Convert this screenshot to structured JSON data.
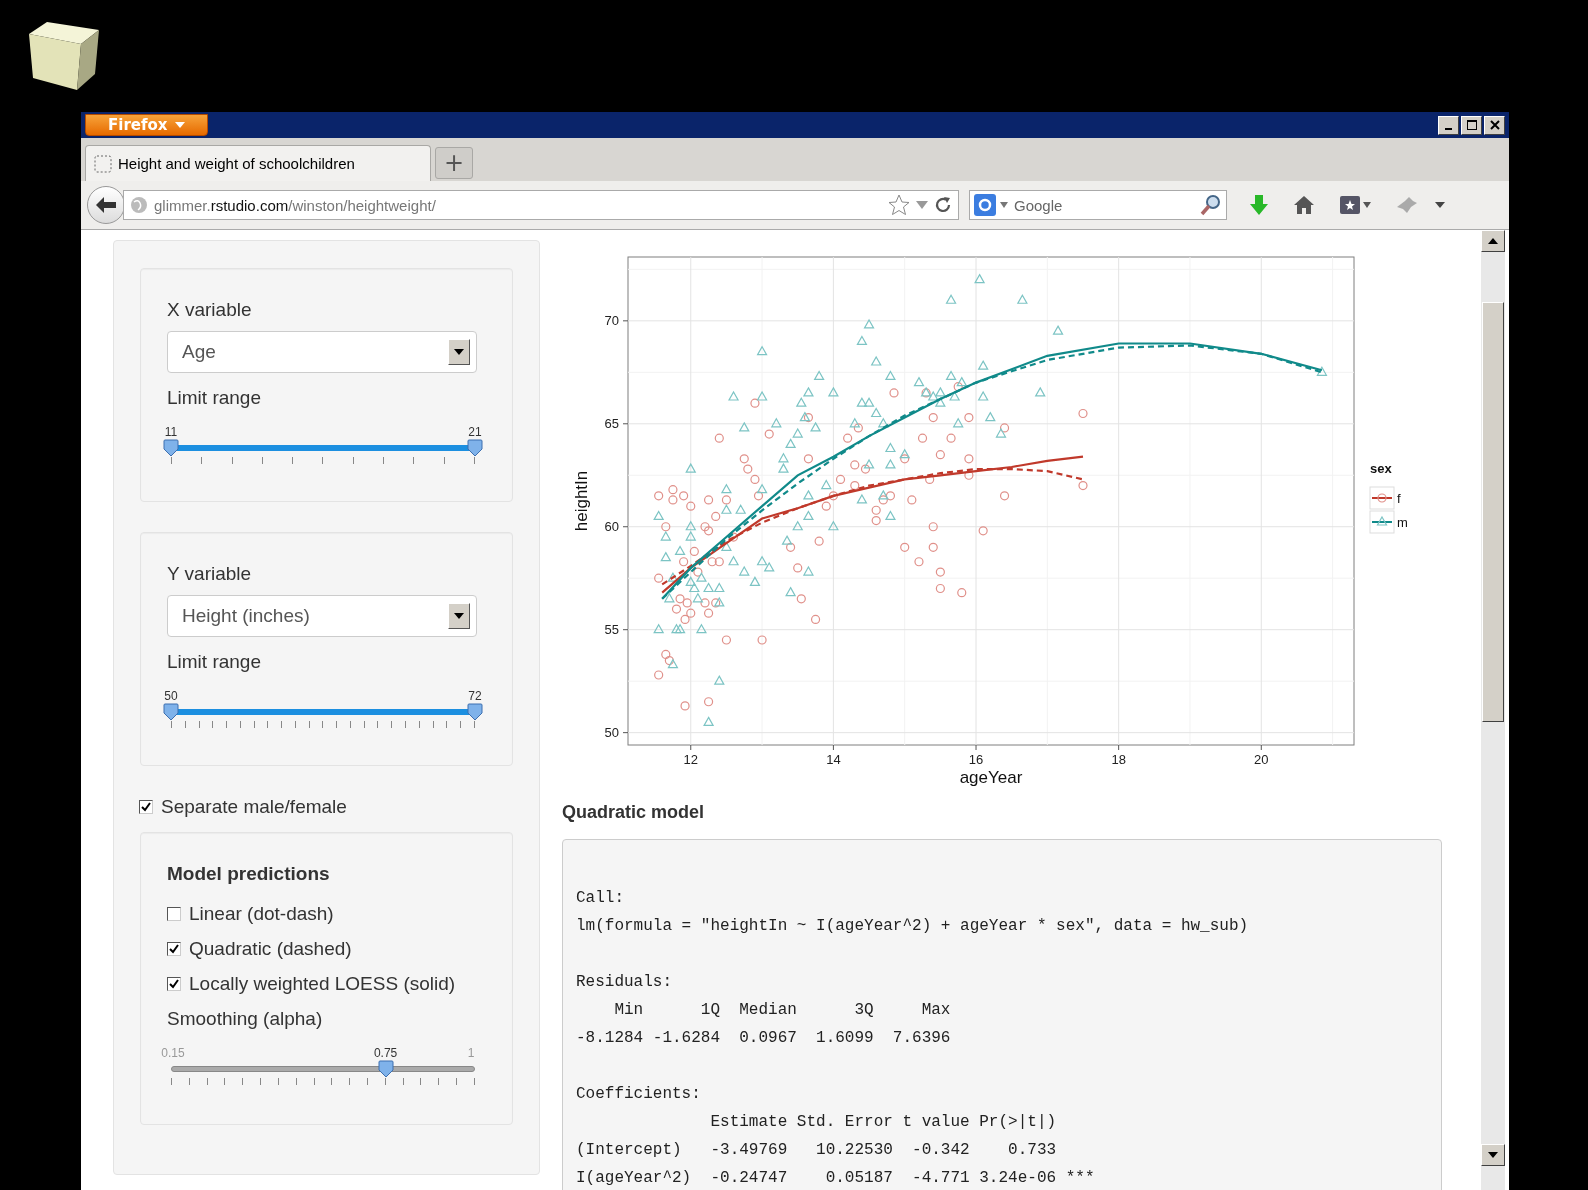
{
  "browser": {
    "menu_button": "Firefox",
    "tabs": [
      {
        "title": "Height and weight of schoolchildren",
        "selected": true
      }
    ],
    "new_tab": "+",
    "url": "glimmer.**rstudio.com**/winston/heightweight/",
    "search": {
      "placeholder": "Google"
    }
  },
  "sidebar": {
    "panels": [
      {
        "label": "X variable",
        "select": "Age",
        "range_label": "Limit range",
        "slider": {
          "kind": "range",
          "thumbs": [
            {
              "label": "11",
              "level": 0
            },
            {
              "label": "21",
              "level": 1
            }
          ]
        }
      },
      {
        "label": "Y variable",
        "select": "Height (inches)",
        "range_label": "Limit range",
        "slider": {
          "kind": "range",
          "thumbs": [
            {
              "label": "50",
              "level": 0
            },
            {
              "label": "72",
              "level": 1
            }
          ]
        }
      }
    ],
    "separate": {
      "label": "Separate male/female",
      "checked": true
    },
    "model_panel": {
      "title": "Model predictions",
      "options": [
        {
          "label": "Linear (dot-dash)",
          "checked": false
        },
        {
          "label": "Quadratic (dashed)",
          "checked": true
        },
        {
          "label": "Locally weighted LOESS (solid)",
          "checked": true
        }
      ],
      "smoothing_label": "Smoothing (alpha)",
      "slider": {
        "kind": "single",
        "min_label": "0.15",
        "max_label": "1",
        "thumbs": [
          {
            "label": "0.75",
            "level": 0.706
          }
        ]
      }
    }
  },
  "plot": {
    "chart_data": {
      "type": "scatter",
      "xlabel": "ageYear",
      "ylabel": "heightIn",
      "grid": true,
      "legend": {
        "title": "sex"
      },
      "xlim": [
        11.12,
        21.3
      ],
      "ylim": [
        49.4,
        73.1
      ],
      "xticks": [
        12,
        14,
        16,
        18,
        20
      ],
      "yticks": [
        {
          "value": 50,
          "label": "50"
        },
        {
          "value": 55,
          "label": "55"
        },
        {
          "value": 60,
          "label": "60"
        },
        {
          "value": 65,
          "label": "65"
        },
        {
          "value": 70,
          "label": "70"
        }
      ],
      "series": [
        {
          "name": "f",
          "color": "#e0908a",
          "x": [
            11.55,
            11.55,
            11.55,
            11.65,
            11.65,
            11.7,
            11.75,
            11.75,
            11.8,
            11.85,
            11.9,
            11.9,
            11.92,
            11.92,
            11.95,
            12,
            12,
            12.05,
            12.1,
            12.2,
            12.2,
            12.25,
            12.25,
            12.25,
            12.25,
            12.3,
            12.35,
            12.35,
            12.4,
            12.4,
            12.5,
            12.5,
            12.6,
            12.75,
            12.8,
            12.9,
            12.9,
            12.95,
            13,
            13.1,
            13.4,
            13.5,
            13.55,
            13.65,
            13.65,
            13.75,
            13.8,
            13.9,
            14,
            14.1,
            14.2,
            14.3,
            14.3,
            14.35,
            14.45,
            14.6,
            14.6,
            14.7,
            14.8,
            14.85,
            15,
            15,
            15.1,
            15.2,
            15.25,
            15.3,
            15.35,
            15.4,
            15.4,
            15.4,
            15.5,
            15.5,
            15.5,
            15.65,
            15.75,
            15.8,
            15.9,
            15.9,
            15.9,
            16.1,
            16.4,
            16.4,
            17.5,
            17.5
          ],
          "values": [
            61.5,
            57.5,
            52.8,
            60,
            53.8,
            53.5,
            61.8,
            61.3,
            56,
            56.5,
            61.5,
            58.3,
            55.5,
            51.3,
            56.3,
            61,
            55.8,
            58.8,
            57.8,
            60,
            56.3,
            59.8,
            61.3,
            55.8,
            51.5,
            58.3,
            60.5,
            56.3,
            64.3,
            58.3,
            61.3,
            54.5,
            59.5,
            63.3,
            62.8,
            62.3,
            66,
            61.5,
            54.5,
            64.5,
            59,
            58,
            56.5,
            65.3,
            63.3,
            55.5,
            59.3,
            61,
            61.5,
            62.3,
            64.3,
            63,
            62,
            64.8,
            62.8,
            60.8,
            60.3,
            61.3,
            61.5,
            66.5,
            59,
            63.3,
            61.3,
            58.3,
            64.3,
            66.5,
            62.3,
            65.3,
            60,
            59,
            63.5,
            57.8,
            57,
            64.3,
            66.8,
            56.8,
            65.3,
            62.5,
            63.3,
            59.8,
            61.5,
            64.8,
            65.5,
            62
          ]
        },
        {
          "name": "m",
          "color": "#7cc4c4",
          "x": [
            11.55,
            11.55,
            11.65,
            11.65,
            11.7,
            11.75,
            11.75,
            11.8,
            11.85,
            11.85,
            12,
            12,
            12,
            12,
            12.05,
            12.1,
            12.15,
            12.15,
            12.25,
            12.25,
            12.4,
            12.4,
            12.4,
            12.5,
            12.5,
            12.5,
            12.6,
            12.6,
            12.7,
            12.75,
            12.75,
            12.9,
            13,
            13,
            13,
            13,
            13.1,
            13.2,
            13.3,
            13.3,
            13.35,
            13.4,
            13.4,
            13.5,
            13.5,
            13.55,
            13.6,
            13.65,
            13.65,
            13.65,
            13.65,
            13.75,
            13.8,
            13.9,
            14,
            14,
            14.3,
            14.4,
            14.4,
            14.4,
            14.5,
            14.5,
            14.5,
            14.6,
            14.6,
            14.7,
            14.7,
            14.8,
            14.8,
            14.8,
            14.8,
            15,
            15.2,
            15.3,
            15.4,
            15.5,
            15.5,
            15.65,
            15.65,
            15.7,
            15.75,
            15.8,
            16.05,
            16.1,
            16.1,
            16.2,
            16.35,
            16.65,
            16.9,
            17.15,
            20.85
          ],
          "values": [
            60.5,
            55,
            59.5,
            58.5,
            56.5,
            53.3,
            57.5,
            55,
            58.8,
            55,
            62.8,
            60,
            59.5,
            57.3,
            57,
            56.5,
            57.5,
            55,
            57,
            50.5,
            57,
            56.3,
            52.5,
            61.8,
            60.8,
            59,
            66.3,
            58.3,
            60.8,
            64.8,
            57.8,
            57.3,
            68.5,
            66.3,
            61.8,
            58.3,
            58,
            65,
            63.3,
            62.8,
            59.3,
            64,
            56.8,
            64.5,
            60,
            66,
            65.3,
            66.5,
            61.5,
            60.5,
            57.8,
            64.8,
            67.3,
            62,
            66.5,
            60,
            65,
            69,
            66,
            61.3,
            69.8,
            66,
            63,
            68,
            65.5,
            65,
            61.5,
            67.3,
            63.8,
            63,
            60.5,
            63.5,
            67,
            66.5,
            66.3,
            66.5,
            66,
            71,
            67.3,
            66.3,
            65,
            67,
            72,
            67.8,
            66.3,
            65.3,
            64.5,
            71,
            66.5,
            69.5,
            67.5
          ]
        },
        {
          "type": "line",
          "line_style": "solid",
          "color": "#c0392b",
          "x": [
            11.6,
            12,
            12.5,
            13,
            13.5,
            14,
            14.5,
            15,
            15.5,
            16,
            16.5,
            17,
            17.5
          ],
          "values": [
            56.8,
            58,
            59.2,
            60.4,
            60.9,
            61.5,
            61.9,
            62.3,
            62.5,
            62.7,
            62.9,
            63.2,
            63.4
          ]
        },
        {
          "type": "line",
          "line_style": "dashed",
          "color": "#c0392b",
          "x": [
            11.6,
            12,
            12.5,
            13,
            13.5,
            14,
            14.5,
            15,
            15.5,
            16,
            16.5,
            17,
            17.5
          ],
          "values": [
            57.2,
            58.1,
            59.3,
            60.2,
            60.9,
            61.5,
            62,
            62.3,
            62.6,
            62.8,
            62.8,
            62.7,
            62.3
          ]
        },
        {
          "type": "line",
          "line_style": "solid",
          "color": "#108a8a",
          "x": [
            11.6,
            12,
            12.5,
            13,
            13.5,
            14,
            14.5,
            15,
            15.5,
            16,
            17,
            18,
            19,
            20,
            20.85
          ],
          "values": [
            56.5,
            58,
            59.5,
            61,
            62.5,
            63.4,
            64.4,
            65.3,
            66.2,
            67,
            68.3,
            68.9,
            68.9,
            68.4,
            67.6
          ]
        },
        {
          "type": "line",
          "line_style": "dashed",
          "color": "#108a8a",
          "x": [
            11.6,
            12,
            12.5,
            13,
            13.5,
            14,
            14.5,
            15,
            15.5,
            16,
            17,
            18,
            19,
            20,
            20.85
          ],
          "values": [
            56.5,
            57.8,
            59.4,
            60.8,
            62.1,
            63.3,
            64.4,
            65.4,
            66.2,
            67,
            68.1,
            68.7,
            68.8,
            68.4,
            67.5
          ]
        }
      ]
    }
  },
  "model": {
    "title": "Quadratic model",
    "output": [
      [
        "Call:",
        "lm(formula = \"heightIn ~ I(ageYear^2) + ageYear * sex\", data = hw_sub)"
      ],
      [
        "Residuals:",
        "    Min      1Q  Median      3Q     Max",
        "-8.1284 -1.6284  0.0967  1.6099  7.6396"
      ],
      [
        "Coefficients:",
        "              Estimate Std. Error t value Pr(>|t|)",
        "(Intercept)   -3.49769   10.22530  -0.342    0.733",
        "I(ageYear^2)  -0.24747    0.05187  -4.771 3.24e-06 ***"
      ]
    ]
  }
}
